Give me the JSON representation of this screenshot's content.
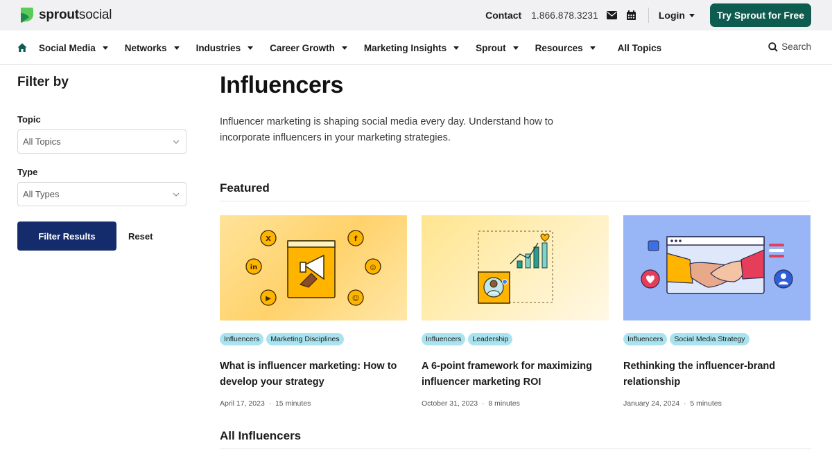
{
  "topbar": {
    "logo_bold": "sprout",
    "logo_light": "social",
    "contact": "Contact",
    "phone": "1.866.878.3231",
    "login": "Login",
    "cta": "Try Sprout for Free"
  },
  "nav": {
    "items": [
      {
        "label": "Social Media",
        "dropdown": true
      },
      {
        "label": "Networks",
        "dropdown": true
      },
      {
        "label": "Industries",
        "dropdown": true
      },
      {
        "label": "Career Growth",
        "dropdown": true
      },
      {
        "label": "Marketing Insights",
        "dropdown": true
      },
      {
        "label": "Sprout",
        "dropdown": true
      },
      {
        "label": "Resources",
        "dropdown": true
      },
      {
        "label": "All Topics",
        "dropdown": false
      }
    ],
    "search_label": "Search"
  },
  "sidebar": {
    "title": "Filter by",
    "topic_label": "Topic",
    "topic_value": "All Topics",
    "type_label": "Type",
    "type_value": "All Types",
    "filter_button": "Filter Results",
    "reset_button": "Reset"
  },
  "content": {
    "title": "Influencers",
    "intro": "Influencer marketing is shaping social media every day. Understand how to incorporate influencers in your marketing strategies.",
    "featured_heading": "Featured",
    "all_heading": "All Influencers",
    "cards": [
      {
        "tags": [
          "Influencers",
          "Marketing Disciplines"
        ],
        "title": "What is influencer marketing: How to develop your strategy",
        "date": "April 17, 2023",
        "read_time": "15 minutes"
      },
      {
        "tags": [
          "Influencers",
          "Leadership"
        ],
        "title": "A 6-point framework for maximizing influencer marketing ROI",
        "date": "October 31, 2023",
        "read_time": "8 minutes"
      },
      {
        "tags": [
          "Influencers",
          "Social Media Strategy"
        ],
        "title": "Rethinking the influencer-brand relationship",
        "date": "January 24, 2024",
        "read_time": "5 minutes"
      }
    ]
  },
  "colors": {
    "brand_green": "#0e5b4f",
    "filter_button": "#142c6b",
    "tag_bg": "#a9e3f0"
  }
}
